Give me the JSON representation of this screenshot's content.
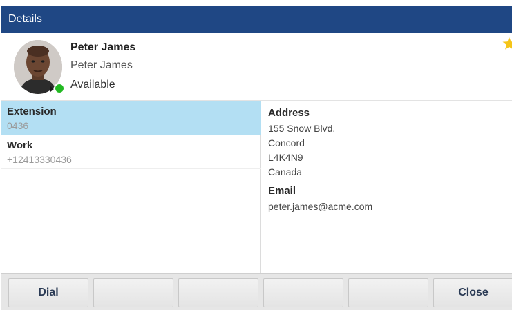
{
  "title_bar": {
    "title": "Details"
  },
  "contact": {
    "display_name": "Peter James",
    "secondary_name": "Peter James",
    "presence": "Available",
    "presence_color": "#22b922",
    "favorite_icon": "star-icon",
    "favorite_color": "#f5c518"
  },
  "phones": [
    {
      "label": "Extension",
      "value": "0436",
      "selected": true
    },
    {
      "label": "Work",
      "value": "+12413330436",
      "selected": false
    }
  ],
  "details": {
    "address_label": "Address",
    "address_lines": [
      "155 Snow Blvd.",
      "Concord",
      "L4K4N9",
      "Canada"
    ],
    "email_label": "Email",
    "email": "peter.james@acme.com"
  },
  "softkeys": [
    "Dial",
    "",
    "",
    "",
    "",
    "Close"
  ],
  "colors": {
    "title_bar_bg": "#1f4784",
    "selected_row_bg": "#b3dff3"
  }
}
